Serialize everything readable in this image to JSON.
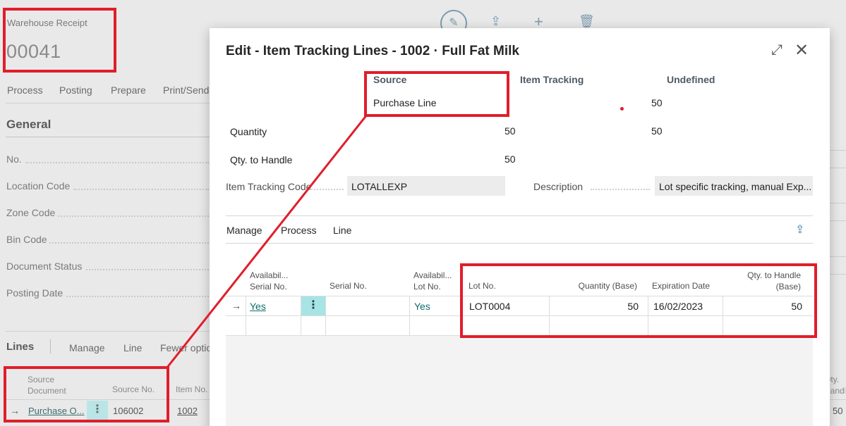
{
  "background": {
    "record": {
      "caption": "Warehouse Receipt",
      "number": "00041"
    },
    "actions": [
      "Process",
      "Posting",
      "Prepare",
      "Print/Send"
    ],
    "section_title": "General",
    "fields": [
      "No.",
      "Location Code",
      "Zone Code",
      "Bin Code",
      "Document Status",
      "Posting Date"
    ],
    "lines": {
      "title": "Lines",
      "actions": [
        "Manage",
        "Line",
        "Fewer options"
      ],
      "headers": {
        "source_document": "Source Document",
        "source_no": "Source No.",
        "item_no": "Item No.",
        "qty": "Qty. Handling"
      },
      "row": {
        "source_document": "Purchase O...",
        "source_no": "106002",
        "item_no": "1002",
        "qty": "50"
      }
    }
  },
  "dialog": {
    "title": "Edit - Item Tracking Lines - 1002 · Full Fat Milk",
    "summary": {
      "headers": {
        "source": "Source",
        "item_tracking": "Item Tracking",
        "undefined": "Undefined"
      },
      "source_value": "Purchase Line",
      "undefined_top": "50",
      "rows": [
        {
          "label": "Quantity",
          "source": "50",
          "undefined": "50"
        },
        {
          "label": "Qty. to Handle",
          "source": "50"
        }
      ]
    },
    "item_tracking_code": {
      "label": "Item Tracking Code",
      "value": "LOTALLEXP"
    },
    "description": {
      "label": "Description",
      "value": "Lot specific tracking, manual Exp..."
    },
    "actions": [
      "Manage",
      "Process",
      "Line"
    ],
    "grid": {
      "headers": {
        "avail_serial": "Availabil... Serial No.",
        "serial_no": "Serial No.",
        "avail_lot": "Availabil... Lot No.",
        "lot_no": "Lot No.",
        "qty_base": "Quantity (Base)",
        "expiration": "Expiration Date",
        "qty_handle": "Qty. to Handle (Base)"
      },
      "rows": [
        {
          "avail_serial": "Yes",
          "serial_no": "",
          "avail_lot": "Yes",
          "lot_no": "LOT0004",
          "qty_base": "50",
          "expiration": "16/02/2023",
          "qty_handle": "50"
        }
      ]
    }
  },
  "colors": {
    "highlight": "#e01e2b",
    "accent": "#0d6c6c",
    "menu_dots": "#a6e4e6"
  }
}
